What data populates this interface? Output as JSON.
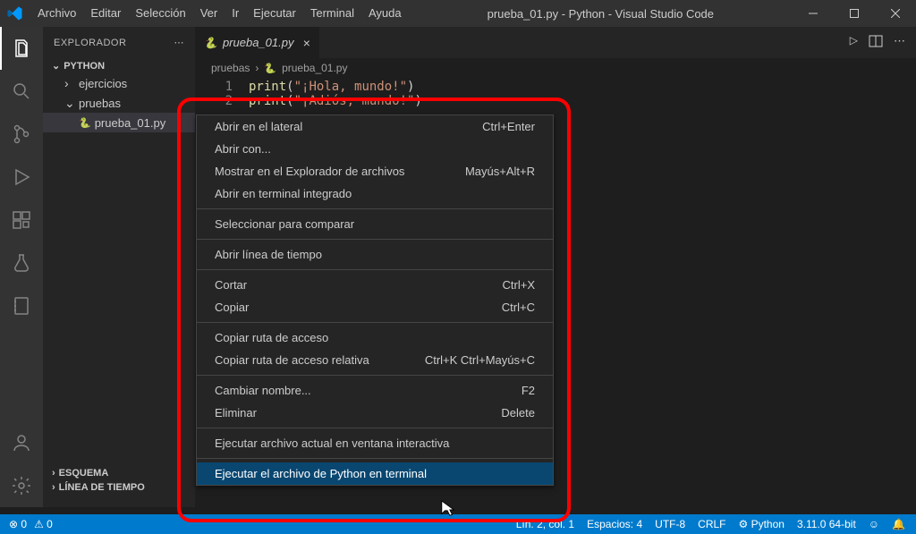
{
  "titlebar": {
    "menus": [
      "Archivo",
      "Editar",
      "Selección",
      "Ver",
      "Ir",
      "Ejecutar",
      "Terminal",
      "Ayuda"
    ],
    "title": "prueba_01.py - Python - Visual Studio Code"
  },
  "sidebar": {
    "title": "EXPLORADOR",
    "project": "PYTHON",
    "items": [
      {
        "name": "ejercicios",
        "type": "folder",
        "depth": 1,
        "open": false
      },
      {
        "name": "pruebas",
        "type": "folder",
        "depth": 1,
        "open": true
      },
      {
        "name": "prueba_01.py",
        "type": "file",
        "depth": 2,
        "selected": true
      }
    ],
    "esquema": "ESQUEMA",
    "linea": "LÍNEA DE TIEMPO"
  },
  "tab": {
    "name": "prueba_01.py"
  },
  "breadcrumbs": [
    "pruebas",
    "prueba_01.py"
  ],
  "code": {
    "lines": [
      {
        "n": "1",
        "print": "print",
        "paren": "(",
        "str": "\"¡Hola, mundo!\"",
        "close": ")"
      },
      {
        "n": "2",
        "print": "print",
        "paren": "(",
        "str": "\"¡Adiós, mundo!\"",
        "close": ")"
      }
    ]
  },
  "context": [
    {
      "label": "Abrir en el lateral",
      "sc": "Ctrl+Enter"
    },
    {
      "label": "Abrir con..."
    },
    {
      "label": "Mostrar en el Explorador de archivos",
      "sc": "Mayús+Alt+R"
    },
    {
      "label": "Abrir en terminal integrado"
    },
    {
      "sep": true
    },
    {
      "label": "Seleccionar para comparar"
    },
    {
      "sep": true
    },
    {
      "label": "Abrir línea de tiempo"
    },
    {
      "sep": true
    },
    {
      "label": "Cortar",
      "sc": "Ctrl+X"
    },
    {
      "label": "Copiar",
      "sc": "Ctrl+C"
    },
    {
      "sep": true
    },
    {
      "label": "Copiar ruta de acceso"
    },
    {
      "label": "Copiar ruta de acceso relativa",
      "sc": "Ctrl+K Ctrl+Mayús+C"
    },
    {
      "sep": true
    },
    {
      "label": "Cambiar nombre...",
      "sc": "F2"
    },
    {
      "label": "Eliminar",
      "sc": "Delete"
    },
    {
      "sep": true
    },
    {
      "label": "Ejecutar archivo actual en ventana interactiva"
    },
    {
      "sep": true
    },
    {
      "label": "Ejecutar el archivo de Python en terminal",
      "hl": true
    }
  ],
  "status": {
    "errors": "0",
    "warnings": "0",
    "lncol": "Lín. 2, col. 1",
    "spaces": "Espacios: 4",
    "enc": "UTF-8",
    "eol": "CRLF",
    "lang": "Python",
    "ver": "3.11.0 64-bit"
  }
}
